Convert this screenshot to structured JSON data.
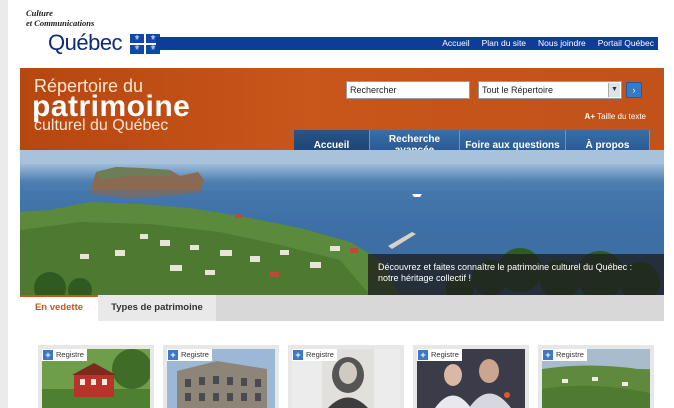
{
  "gov_header": {
    "logo_line1": "Culture",
    "logo_line2": "et Communications",
    "logo_name": "Québec",
    "flag_icon": "quebec-fleurdelise-flag",
    "nav": [
      "Accueil",
      "Plan du site",
      "Nous joindre",
      "Portail Québec"
    ]
  },
  "banner": {
    "title_line1": "Répertoire du",
    "title_line2": "patrimoine",
    "title_line3": "culturel du Québec",
    "search_value": "Rechercher",
    "scope_selected": "Tout le Répertoire",
    "search_go_icon": "arrow-right-icon",
    "text_size_prefix": "A+",
    "text_size_label": "Taille du texte",
    "colors": {
      "banner": "#c9561a",
      "nav": "#23508a",
      "gov_nav": "#0f3c98"
    }
  },
  "main_nav": [
    {
      "label": "Accueil"
    },
    {
      "label": "Recherche avancée"
    },
    {
      "label": "Foire aux questions"
    },
    {
      "label": "À propos"
    }
  ],
  "hero": {
    "caption": "Découvrez et faites connaître le patrimoine culturel du Québec : notre héritage collectif !"
  },
  "content_tabs": [
    {
      "label": "En vedette"
    },
    {
      "label": "Types de patrimoine"
    }
  ],
  "cards": [
    {
      "badge": "Registre",
      "image": "red-house"
    },
    {
      "badge": "Registre",
      "image": "stone-building"
    },
    {
      "badge": "Registre",
      "image": "portrait-engraving"
    },
    {
      "badge": "Registre",
      "image": "people-event"
    },
    {
      "badge": "Registre",
      "image": "village-landscape"
    }
  ]
}
